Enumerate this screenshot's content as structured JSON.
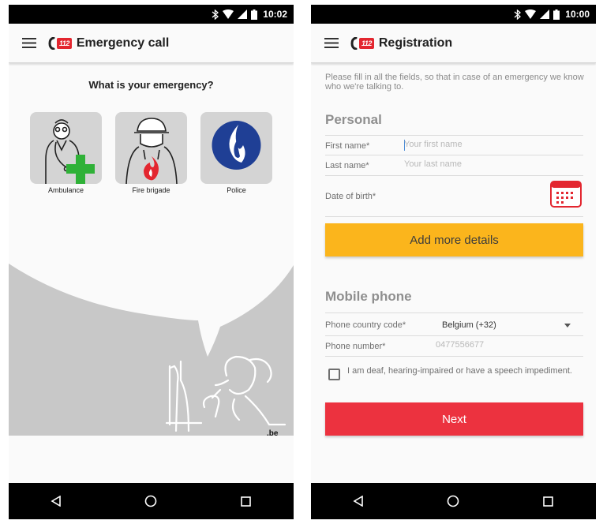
{
  "left_screen": {
    "status": {
      "time": "10:02"
    },
    "app_bar": {
      "logo_text": "112",
      "title": "Emergency call"
    },
    "question": "What is your emergency?",
    "tiles": [
      {
        "label": "Ambulance",
        "icon": "ambulance-icon"
      },
      {
        "label": "Fire brigade",
        "icon": "fire-brigade-icon"
      },
      {
        "label": "Police",
        "icon": "police-icon"
      }
    ],
    "brand_mark": ".be",
    "nav": {
      "back": "back-icon",
      "home": "home-icon",
      "recents": "recents-icon"
    }
  },
  "right_screen": {
    "status": {
      "time": "10:00"
    },
    "app_bar": {
      "logo_text": "112",
      "title": "Registration"
    },
    "intro": "Please fill in all the fields, so that in case of an emergency we know who we're talking to.",
    "personal": {
      "title": "Personal",
      "first_name_label": "First name*",
      "first_name_placeholder": "Your first name",
      "last_name_label": "Last name*",
      "last_name_placeholder": "Your last name",
      "dob_label": "Date of birth*"
    },
    "add_more_details": "Add more details",
    "mobile": {
      "title": "Mobile phone",
      "country_code_label": "Phone country code*",
      "country_code_value": "Belgium (+32)",
      "phone_label": "Phone number*",
      "phone_placeholder": "0477556677"
    },
    "checkbox_label": "I am deaf, hearing-impaired or have a speech impediment.",
    "next_button": "Next"
  },
  "colors": {
    "brand_red": "#e3262f",
    "yellow_button": "#fbb51c",
    "red_button": "#ec323f",
    "tile_gray": "#d4d4d4",
    "police_blue": "#1f3f95",
    "ambulance_green": "#2fb137"
  }
}
